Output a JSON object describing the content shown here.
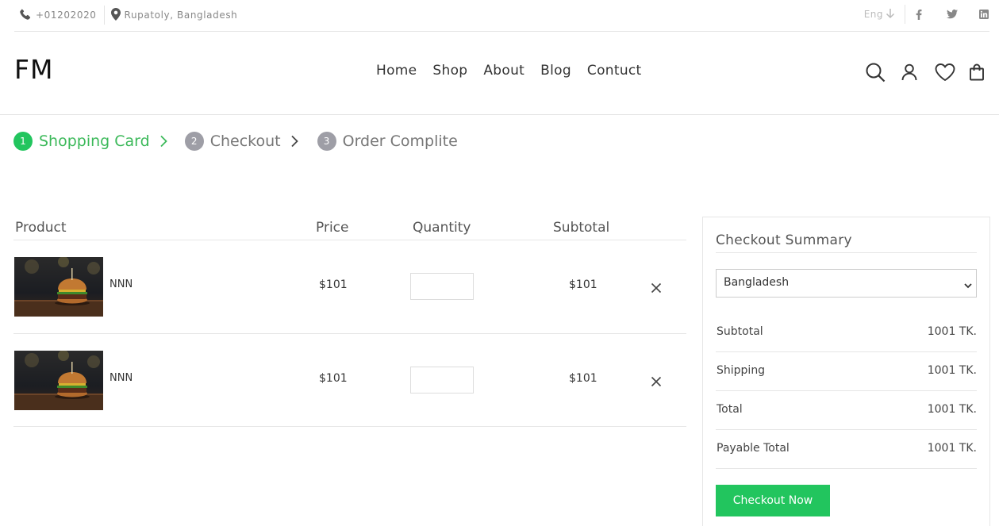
{
  "topbar": {
    "phone": "+01202020",
    "location": "Rupatoly, Bangladesh",
    "language": "Eng",
    "social": [
      "facebook-icon",
      "twitter-icon",
      "linkedin-icon"
    ]
  },
  "header": {
    "logo": "FM",
    "nav": [
      "Home",
      "Shop",
      "About",
      "Blog",
      "Contuct"
    ],
    "icons": [
      "search-icon",
      "user-icon",
      "heart-icon",
      "bag-icon"
    ]
  },
  "steps": [
    {
      "num": "1",
      "label": "Shopping Card",
      "active": true
    },
    {
      "num": "2",
      "label": "Checkout",
      "active": false
    },
    {
      "num": "3",
      "label": "Order Complite",
      "active": false
    }
  ],
  "cart": {
    "headers": {
      "product": "Product",
      "price": "Price",
      "quantity": "Quantity",
      "subtotal": "Subtotal"
    },
    "rows": [
      {
        "name": "NNN",
        "price": "$101",
        "quantity": "",
        "subtotal": "$101"
      },
      {
        "name": "NNN",
        "price": "$101",
        "quantity": "",
        "subtotal": "$101"
      }
    ]
  },
  "summary": {
    "title": "Checkout Summary",
    "country": "Bangladesh",
    "rows": [
      {
        "label": "Subtotal",
        "value": "1001 TK."
      },
      {
        "label": "Shipping",
        "value": "1001 TK."
      },
      {
        "label": "Total",
        "value": "1001 TK."
      },
      {
        "label": "Payable Total",
        "value": "1001 TK."
      }
    ],
    "button": "Checkout Now"
  },
  "colors": {
    "accent": "#22c55e",
    "step_active_text": "#3cb95a",
    "step_inactive": "#9e9ea6"
  }
}
